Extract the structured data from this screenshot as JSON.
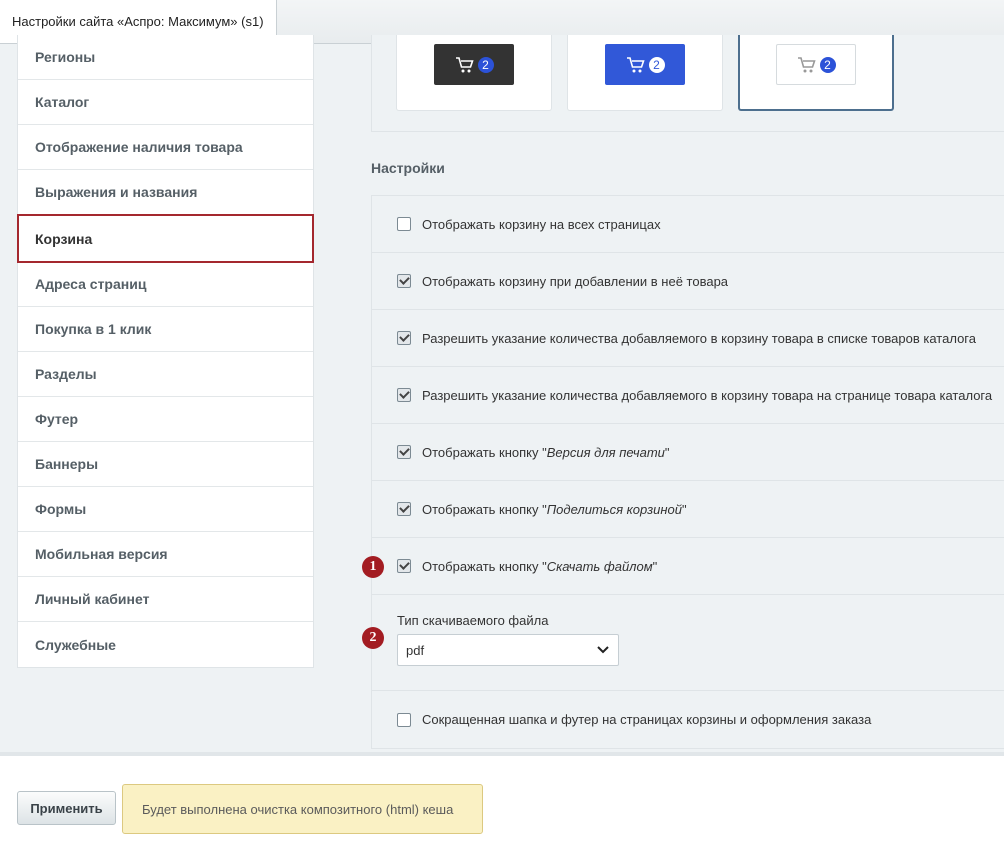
{
  "tab": {
    "title": "Настройки сайта «Аспро: Максимум» (s1)"
  },
  "sidebar": {
    "items": [
      {
        "label": "Регионы"
      },
      {
        "label": "Каталог"
      },
      {
        "label": "Отображение наличия товара"
      },
      {
        "label": "Выражения и названия"
      },
      {
        "label": "Корзина",
        "active": true
      },
      {
        "label": "Адреса страниц"
      },
      {
        "label": "Покупка в 1 клик"
      },
      {
        "label": "Разделы"
      },
      {
        "label": "Футер"
      },
      {
        "label": "Баннеры"
      },
      {
        "label": "Формы"
      },
      {
        "label": "Мобильная версия"
      },
      {
        "label": "Личный кабинет"
      },
      {
        "label": "Служебные"
      }
    ]
  },
  "preview": {
    "cards": [
      {
        "style": "dark",
        "count": "2"
      },
      {
        "style": "blue",
        "count": "2"
      },
      {
        "style": "light",
        "count": "2",
        "selected": true
      }
    ]
  },
  "settings": {
    "heading": "Настройки",
    "options": [
      {
        "label": "Отображать корзину на всех страницах",
        "checked": false
      },
      {
        "label": "Отображать корзину при добавлении в неё товара",
        "checked": true
      },
      {
        "label": "Разрешить указание количества добавляемого в корзину товара в списке товаров каталога",
        "checked": true
      },
      {
        "label": "Разрешить указание количества добавляемого в корзину товара на странице товара каталога",
        "checked": true
      },
      {
        "prefix": "Отображать кнопку \"",
        "italic": "Версия для печати",
        "suffix": "\"",
        "checked": true
      },
      {
        "prefix": "Отображать кнопку \"",
        "italic": "Поделиться корзиной",
        "suffix": "\"",
        "checked": true
      },
      {
        "prefix": "Отображать кнопку \"",
        "italic": "Скачать файлом",
        "suffix": "\"",
        "checked": true
      }
    ],
    "file_type": {
      "label": "Тип скачиваемого файла",
      "value": "pdf"
    },
    "last_option": {
      "label": "Сокращенная шапка и футер на страницах корзины и оформления заказа",
      "checked": false
    }
  },
  "markers": {
    "one": "1",
    "two": "2"
  },
  "footer": {
    "apply_label": "Применить",
    "notice": "Будет выполнена очистка композитного (html) кеша"
  }
}
